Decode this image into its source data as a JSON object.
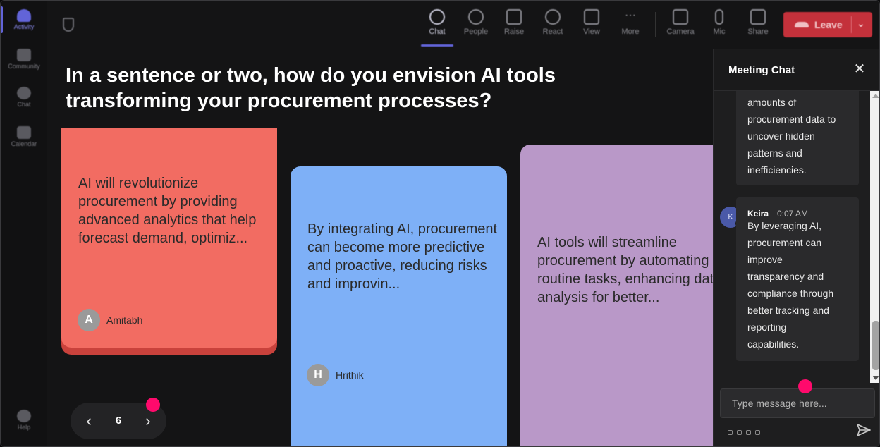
{
  "rail": {
    "items": [
      {
        "label": "Activity",
        "icon": "bell-icon",
        "active": true
      },
      {
        "label": "Community",
        "icon": "community-icon",
        "active": false
      },
      {
        "label": "Chat",
        "icon": "chat-icon",
        "active": false
      },
      {
        "label": "Calendar",
        "icon": "calendar-icon",
        "active": false
      }
    ],
    "help_label": "Help"
  },
  "toolbar": {
    "chat": "Chat",
    "people": "People",
    "raise": "Raise",
    "react": "React",
    "view": "View",
    "more": "More",
    "camera": "Camera",
    "mic": "Mic",
    "share": "Share",
    "leave": "Leave"
  },
  "question": "In a sentence or two, how do you envision AI tools transforming your procurement processes?",
  "cards": [
    {
      "text": "AI will revolutionize procurement by providing advanced analytics that help forecast demand, optimiz...",
      "initial": "A",
      "author": "Amitabh",
      "color": "#f26c62"
    },
    {
      "text": "By integrating AI, procurement can become more predictive and proactive, reducing risks and improvin...",
      "initial": "H",
      "author": "Hrithik",
      "color": "#7eb0f7"
    },
    {
      "text": "AI tools will streamline procurement by automating routine tasks, enhancing data analysis for better...",
      "color": "#b998c8"
    }
  ],
  "pager": {
    "page": "6"
  },
  "chat": {
    "title": "Meeting Chat",
    "messages": [
      {
        "text_lines": [
          "amounts of",
          "procurement data to",
          "uncover hidden",
          "patterns and",
          "inefficiencies."
        ]
      },
      {
        "sender": "Keira",
        "initial": "K",
        "time": "0:07 AM",
        "text_lines": [
          "By leveraging AI,",
          "procurement can",
          "improve",
          "transparency and",
          "compliance through",
          "better tracking and",
          "reporting",
          "capabilities."
        ]
      }
    ],
    "input_placeholder": "Type message here..."
  },
  "colors": {
    "accent": "#6264d8",
    "leave": "#c4313b",
    "highlight_dot": "#ff0a6c"
  }
}
